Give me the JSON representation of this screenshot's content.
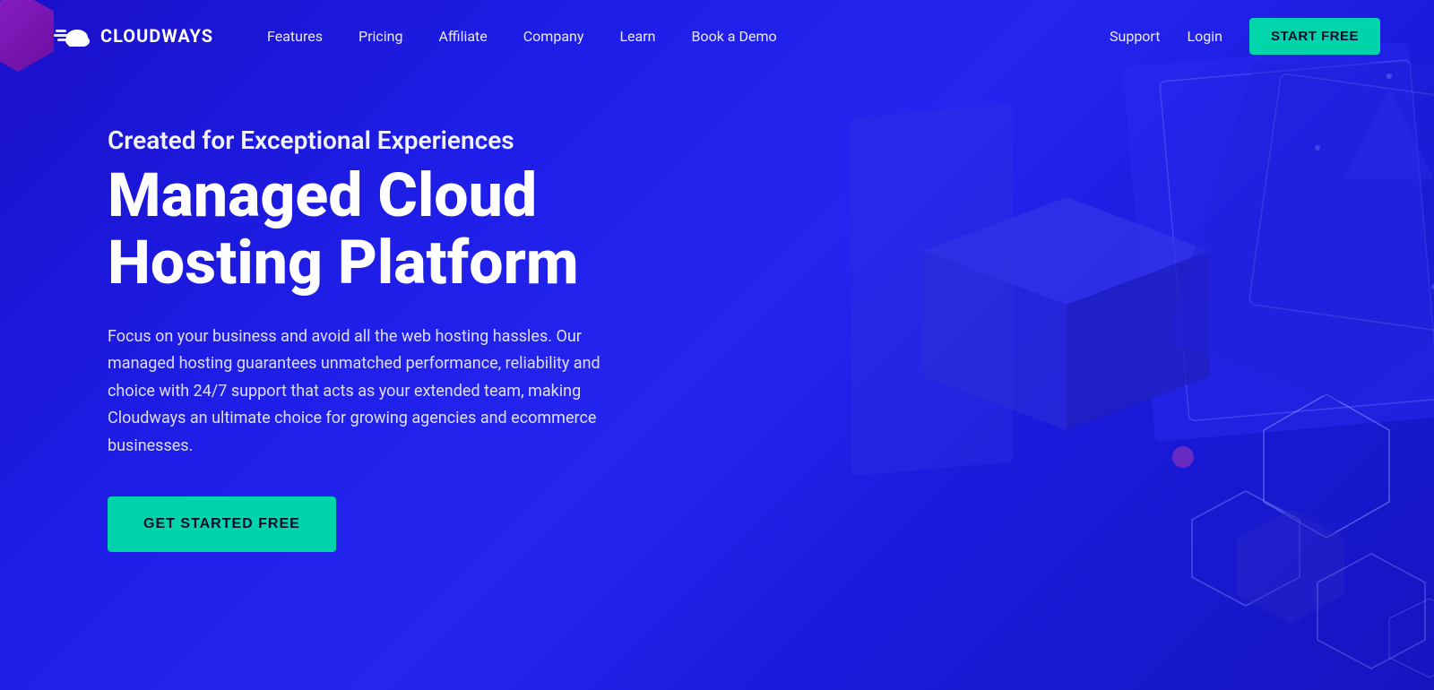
{
  "brand": {
    "name": "CLOUDWAYS",
    "logo_alt": "Cloudways logo"
  },
  "nav": {
    "links": [
      {
        "label": "Features",
        "id": "features"
      },
      {
        "label": "Pricing",
        "id": "pricing"
      },
      {
        "label": "Affiliate",
        "id": "affiliate"
      },
      {
        "label": "Company",
        "id": "company"
      },
      {
        "label": "Learn",
        "id": "learn"
      },
      {
        "label": "Book a Demo",
        "id": "book-demo"
      }
    ],
    "right_links": [
      {
        "label": "Support",
        "id": "support"
      },
      {
        "label": "Login",
        "id": "login"
      }
    ],
    "cta_label": "START FREE"
  },
  "hero": {
    "subtitle": "Created for Exceptional Experiences",
    "title": "Managed Cloud Hosting Platform",
    "description": "Focus on your business and avoid all the web hosting hassles. Our managed hosting guarantees unmatched performance, reliability and choice with 24/7 support that acts as your extended team, making Cloudways an ultimate choice for growing agencies and ecommerce businesses.",
    "cta_label": "GET STARTED FREE"
  },
  "colors": {
    "background_start": "#1a10c8",
    "background_end": "#1515c0",
    "accent_green": "#00d4aa",
    "text_white": "#ffffff",
    "purple_hex": "#8b1fc8"
  }
}
